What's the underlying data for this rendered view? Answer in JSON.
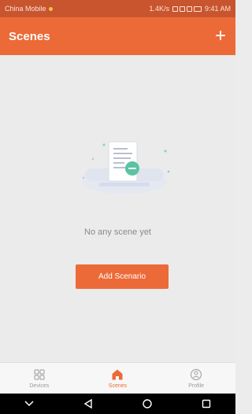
{
  "status_bar": {
    "carrier": "China Mobile",
    "network_speed": "1.4K/s",
    "time": "9:41 AM"
  },
  "header": {
    "title": "Scenes",
    "add_icon": "plus-icon"
  },
  "empty_state": {
    "message": "No any scene yet",
    "illustration": "document-illustration"
  },
  "add_button": {
    "label": "Add Scenario"
  },
  "bottom_nav": {
    "items": [
      {
        "label": "Devices",
        "icon": "grid-icon",
        "active": false
      },
      {
        "label": "Scenes",
        "icon": "home-icon",
        "active": true
      },
      {
        "label": "Profile",
        "icon": "profile-icon",
        "active": false
      }
    ]
  },
  "system_nav": {
    "items": [
      "chevron-down-icon",
      "back-icon",
      "home-circle-icon",
      "recents-icon"
    ]
  },
  "colors": {
    "accent": "#ec6a37",
    "status_bar": "#c8552e",
    "background": "#ebebeb"
  }
}
